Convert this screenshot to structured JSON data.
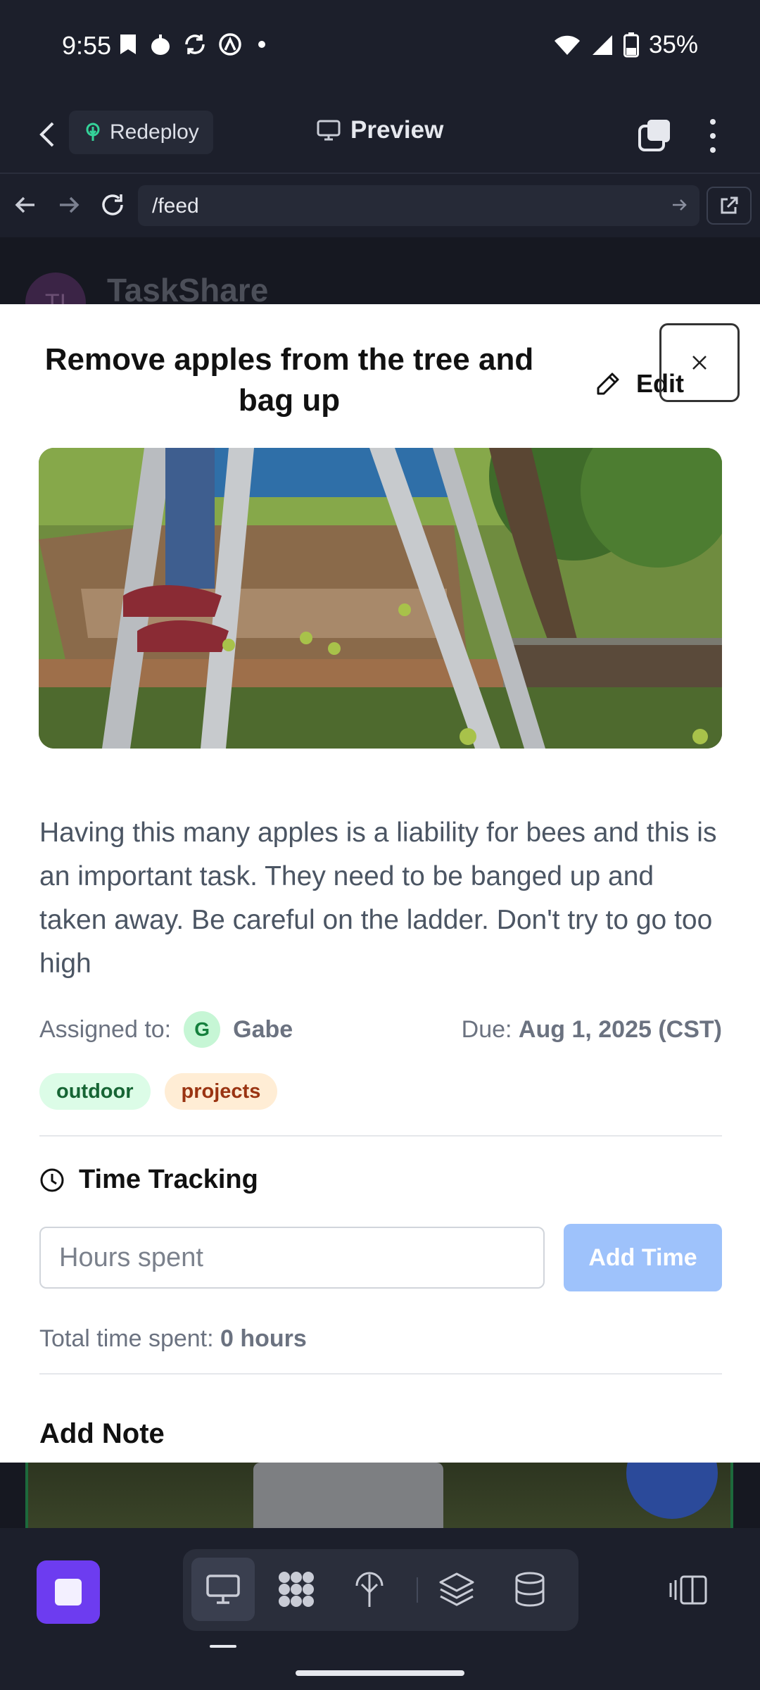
{
  "status_bar": {
    "time": "9:55",
    "battery": "35%",
    "icons": [
      "bookmark-notification-icon",
      "fruit-notification-icon",
      "sync-icon",
      "assistant-icon",
      "dot-icon",
      "wifi-icon",
      "signal-icon",
      "battery-icon"
    ]
  },
  "app_header": {
    "redeploy_label": "Redeploy",
    "preview_label": "Preview"
  },
  "browser": {
    "url": "/feed"
  },
  "background_page": {
    "logo_initials": "TI",
    "app_name": "TaskShare"
  },
  "task": {
    "title": "Remove apples from the tree and bag up",
    "edit_label": "Edit",
    "description": "Having this many apples is a liability for bees and this is an important task. They need to be banged up and taken away. Be careful on the ladder. Don't try to go too high",
    "assigned_label": "Assigned to:",
    "assignee_initial": "G",
    "assignee_name": "Gabe",
    "due_label": "Due:",
    "due_value": "Aug 1, 2025 (CST)",
    "tags": [
      "outdoor",
      "projects"
    ]
  },
  "time_tracking": {
    "heading": "Time Tracking",
    "input_placeholder": "Hours spent",
    "add_button": "Add Time",
    "total_label": "Total time spent:",
    "total_value": "0 hours"
  },
  "add_note": {
    "heading": "Add Note"
  },
  "colors": {
    "accent_purple": "#6d3cf0",
    "add_time_button": "#9ec2fb",
    "tag_outdoor_bg": "#dcfce7",
    "tag_projects_bg": "#ffedd5",
    "dark_chrome": "#1c1f2b"
  }
}
